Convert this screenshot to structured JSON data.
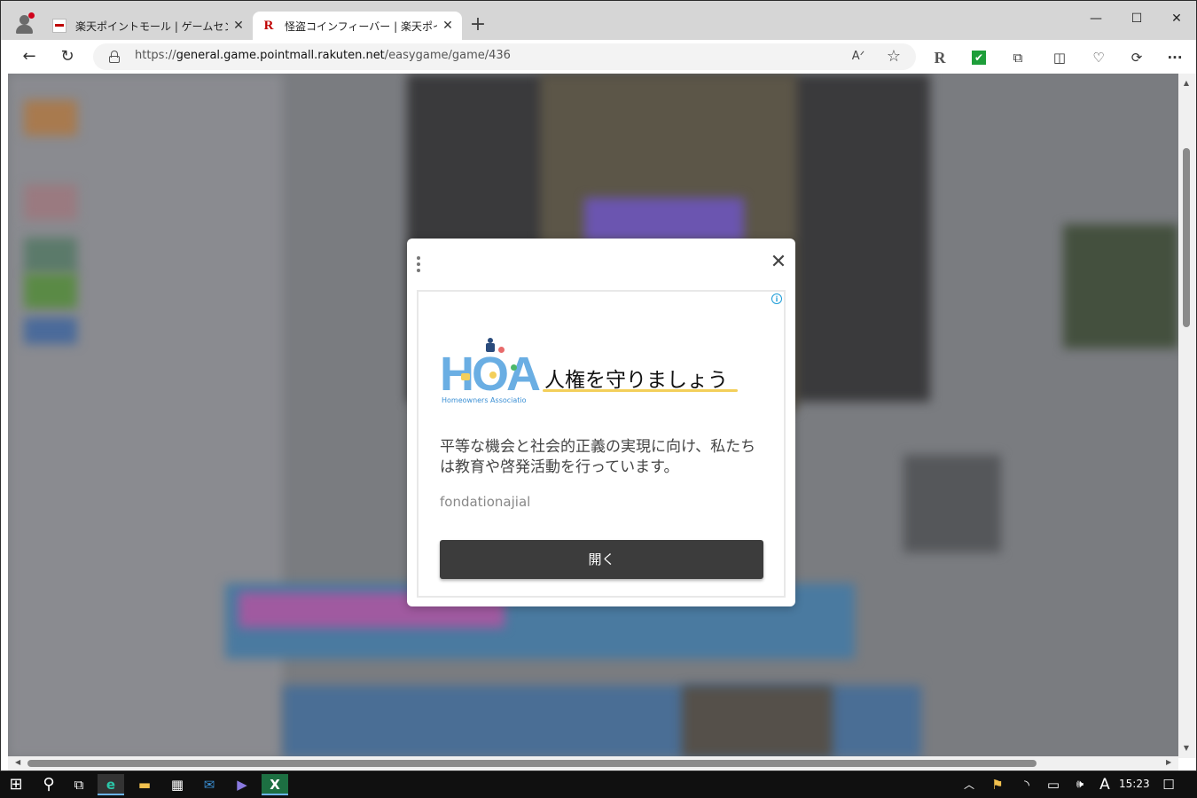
{
  "browser": {
    "tabs": [
      {
        "title": "楽天ポイントモール | ゲームセンター",
        "active": false
      },
      {
        "title": "怪盗コインフィーバー | 楽天ポイントモ",
        "active": true
      }
    ],
    "url_prefix": "https://",
    "url_host": "general.game.pointmall.rakuten.net",
    "url_path": "/easygame/game/436",
    "icons": {
      "back": "back-arrow-icon",
      "refresh": "refresh-icon",
      "read_aloud": "read-aloud-icon",
      "favorite": "star-icon",
      "rakuten": "rakuten-extension-icon",
      "check": "check-extension-icon",
      "extensions": "puzzle-icon",
      "split": "split-screen-icon",
      "performance": "heart-pulse-icon",
      "copilot": "copilot-icon",
      "more": "more-icon"
    },
    "glyphs": {
      "tab_close": "✕",
      "new_tab": "+",
      "minimize": "—",
      "maximize": "☐",
      "close": "✕",
      "back": "←",
      "refresh": "↻",
      "read_aloud": "Aᐟ",
      "favorite": "☆",
      "rakuten": "R",
      "check": "✔",
      "extensions": "⧉",
      "split": "◫",
      "performance": "♡",
      "copilot": "⟳",
      "more": "···"
    }
  },
  "ad": {
    "logo_text": "HOA",
    "logo_subtitle": "Homeowners Associatio",
    "headline": "人権を守りましょう",
    "description": "平等な機会と社会的正義の実現に向け、私たちは教育や啓発活動を行っています。",
    "advertiser": "fondationajial",
    "cta": "開く",
    "info_glyph": "i",
    "close_glyph": "✕",
    "colors": {
      "button": "#3c3c3c",
      "logo": "#6aaee3",
      "underline": "#f3cf5a"
    }
  },
  "taskbar": {
    "clock": "15:23",
    "ime": "A",
    "glyphs": {
      "start": "⊞",
      "search": "⚲",
      "taskview": "⧉",
      "edge": "e",
      "explorer": "▬",
      "store": "▦",
      "mail": "✉",
      "media": "▶",
      "excel": "X",
      "chevron": "︿",
      "security": "⚑",
      "network": "◝",
      "battery": "▭",
      "volume": "🕪",
      "notifications": "☐"
    }
  }
}
